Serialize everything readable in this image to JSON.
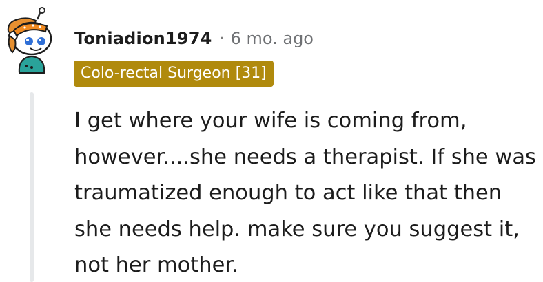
{
  "comment": {
    "username": "Toniadion1974",
    "separator": "·",
    "age": "6 mo. ago",
    "flair": "Colo-rectal Surgeon [31]",
    "body": "I get where your wife is coming from, however....she needs a therapist. If she was traumatized enough to act like that then she needs help. make sure you suggest it, not her mother."
  },
  "colors": {
    "flair_bg": "#b08a0d",
    "text": "#1c1c1c",
    "meta": "#6f7174",
    "thread_line": "#e6e8ea"
  },
  "icons": {
    "avatar": "snoo-avatar-with-bandana"
  }
}
